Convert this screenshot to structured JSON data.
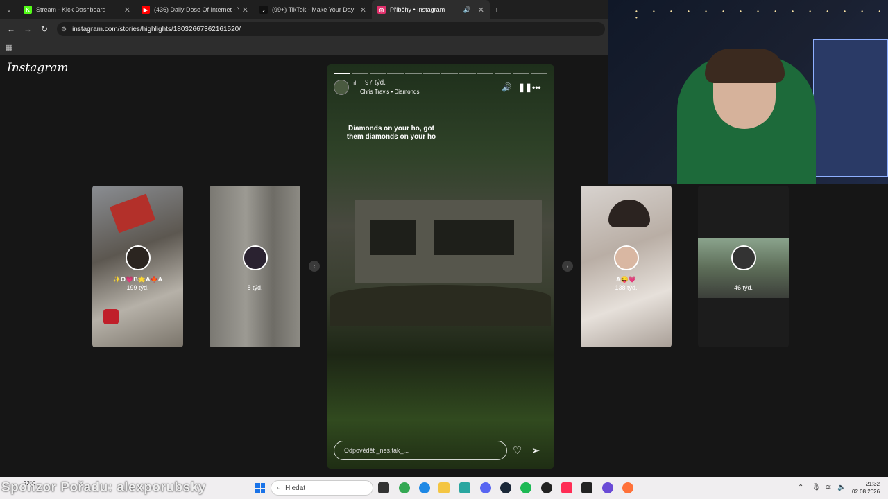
{
  "browser": {
    "tabs": [
      {
        "title": "Stream - Kick Dashboard",
        "active": false,
        "favicon_color": "#53fc18",
        "favicon_glyph": "K"
      },
      {
        "title": "(436) Daily Dose Of Internet - Y",
        "active": false,
        "favicon_color": "#ff0000",
        "favicon_glyph": "▶"
      },
      {
        "title": "(99+) TikTok - Make Your Day",
        "active": false,
        "favicon_color": "#111111",
        "favicon_glyph": "♪"
      },
      {
        "title": "Příběhy • Instagram",
        "active": true,
        "favicon_color": "#e1306c",
        "favicon_glyph": "◎"
      }
    ],
    "url": "instagram.com/stories/highlights/18032667362161520/"
  },
  "instagram": {
    "logo": "Instagram",
    "side_stories": [
      {
        "name": "✨O💗B🌟A🍁A",
        "time": "199 týd."
      },
      {
        "name": "",
        "time": "8 týd."
      },
      {
        "name": "A😝💗",
        "time": "138 týd."
      },
      {
        "name": "",
        "time": "46 týd."
      }
    ],
    "main_story": {
      "time": "97 týd.",
      "music": "Chris Travis • Diamonds",
      "caption": "Diamonds on your ho, got them diamonds on your ho",
      "reply_placeholder": "Odpovědět _nes.tak_...",
      "segments_total": 12,
      "segments_done": 1
    }
  },
  "stream": {
    "sponsor_text": "Sponzor Pořadu: alexporubsky"
  },
  "taskbar": {
    "weather": "22°C",
    "search_placeholder": "Hledat",
    "time": "21:32",
    "date": "02.08.2026"
  }
}
